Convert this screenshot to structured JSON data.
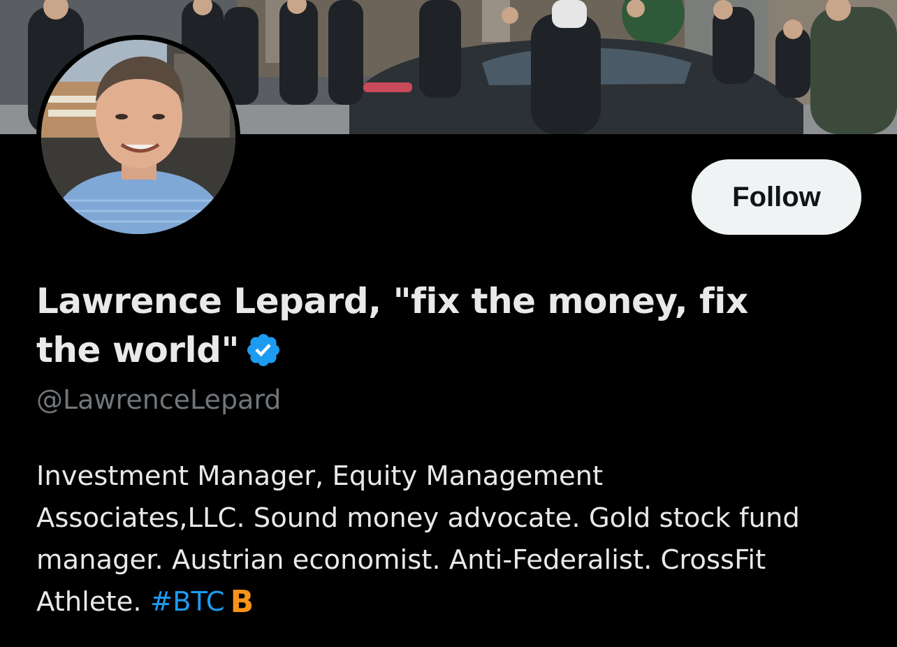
{
  "profile": {
    "display_name_line1": "Lawrence Lepard, \"fix the money, fix",
    "display_name_line2": "the world\"",
    "handle": "@LawrenceLepard",
    "follow_label": "Follow",
    "verified_icon": "verified-badge-icon",
    "bio": {
      "line1": "Investment Manager, Equity Management",
      "line2": "Associates,LLC. Sound money advocate. Gold stock fund",
      "line3": "manager. Austrian economist. Anti-Federalist. CrossFit",
      "line4_text": "Athlete. ",
      "hashtag": "#BTC",
      "emoji": "B"
    }
  },
  "colors": {
    "background": "#000000",
    "text_primary": "#e7e9ea",
    "text_secondary": "#71767b",
    "link": "#1d9bf0",
    "verified": "#1d9bf0",
    "bitcoin": "#f7931a",
    "follow_button_bg": "#eff3f4",
    "follow_button_text": "#0f1419"
  },
  "icons": {
    "banner": "banner-photo",
    "avatar": "profile-photo",
    "verified": "verified-badge-icon",
    "bitcoin": "bitcoin-icon"
  }
}
